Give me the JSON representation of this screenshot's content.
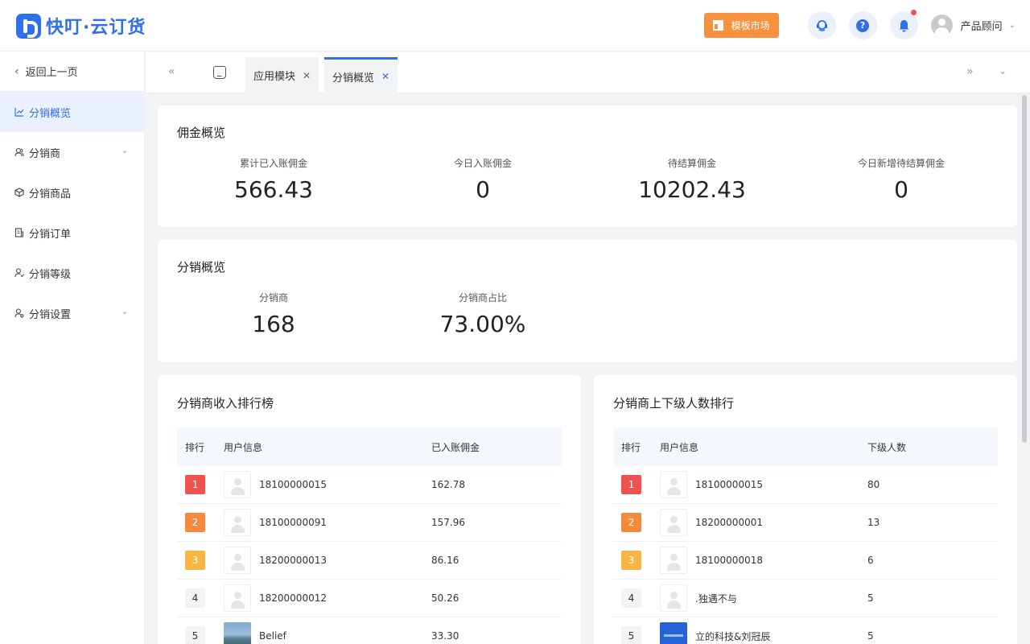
{
  "app": {
    "logo_text": "快叮·云订货"
  },
  "header": {
    "market_label": "模板市场",
    "user_name": "产品顾问",
    "icons": [
      "customer-service-icon",
      "help-icon",
      "bell-icon",
      "user-avatar-icon"
    ]
  },
  "sidebar": {
    "back_label": "返回上一页",
    "items": [
      {
        "label": "分销概览",
        "icon": "chart-icon",
        "active": true
      },
      {
        "label": "分销商",
        "icon": "users-icon",
        "expandable": true
      },
      {
        "label": "分销商品",
        "icon": "box-icon"
      },
      {
        "label": "分销订单",
        "icon": "order-icon"
      },
      {
        "label": "分销等级",
        "icon": "level-icon"
      },
      {
        "label": "分销设置",
        "icon": "settings-icon",
        "expandable": true
      }
    ]
  },
  "tabs": [
    {
      "label": "应用模块",
      "active": false
    },
    {
      "label": "分销概览",
      "active": true
    }
  ],
  "commission": {
    "title": "佣金概览",
    "stats": [
      {
        "label": "累计已入账佣金",
        "value": "566.43"
      },
      {
        "label": "今日入账佣金",
        "value": "0"
      },
      {
        "label": "待结算佣金",
        "value": "10202.43"
      },
      {
        "label": "今日新增待结算佣金",
        "value": "0"
      }
    ]
  },
  "distribution": {
    "title": "分销概览",
    "stats": [
      {
        "label": "分销商",
        "value": "168"
      },
      {
        "label": "分销商占比",
        "value": "73.00%"
      }
    ]
  },
  "income_ranking": {
    "title": "分销商收入排行榜",
    "columns": [
      "排行",
      "用户信息",
      "已入账佣金"
    ],
    "rows": [
      {
        "rank": "1",
        "user": "18100000015",
        "value": "162.78",
        "avatar": "default"
      },
      {
        "rank": "2",
        "user": "18100000091",
        "value": "157.96",
        "avatar": "default"
      },
      {
        "rank": "3",
        "user": "18200000013",
        "value": "86.16",
        "avatar": "default"
      },
      {
        "rank": "4",
        "user": "18200000012",
        "value": "50.26",
        "avatar": "default"
      },
      {
        "rank": "5",
        "user": "Belief",
        "value": "33.30",
        "avatar": "photo"
      }
    ]
  },
  "subordinate_ranking": {
    "title": "分销商上下级人数排行",
    "columns": [
      "排行",
      "用户信息",
      "下级人数"
    ],
    "rows": [
      {
        "rank": "1",
        "user": "18100000015",
        "value": "80",
        "avatar": "default"
      },
      {
        "rank": "2",
        "user": "18200000001",
        "value": "13",
        "avatar": "default"
      },
      {
        "rank": "3",
        "user": "18100000018",
        "value": "6",
        "avatar": "default"
      },
      {
        "rank": "4",
        "user": ".独遇不与",
        "value": "5",
        "avatar": "default"
      },
      {
        "rank": "5",
        "user": "立的科技&刘冠辰",
        "value": "5",
        "avatar": "brand"
      }
    ]
  },
  "colors": {
    "primary": "#2f6fea",
    "orange": "#f7913d",
    "rank1": "#f0524f",
    "rank2": "#f58a3c",
    "rank3": "#f7b644"
  }
}
